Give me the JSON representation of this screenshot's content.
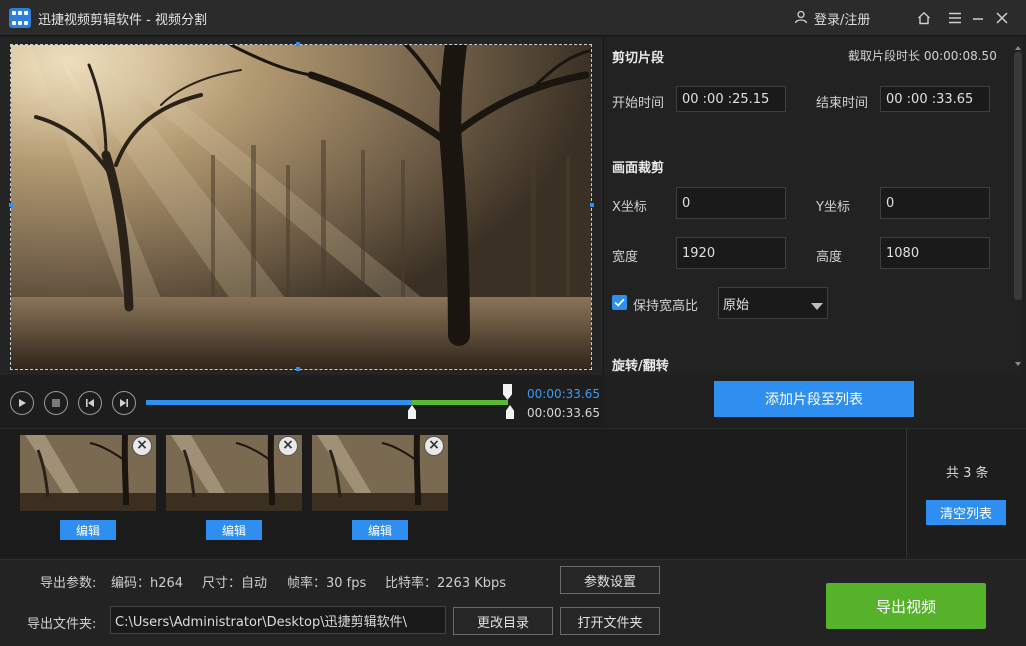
{
  "app": {
    "title": "迅捷视频剪辑软件 - 视频分割",
    "login_label": "登录/注册"
  },
  "icons": {
    "logo": "video-editor-logo-icon",
    "user": "user-icon",
    "home": "home-icon",
    "menu": "menu-icon",
    "minimize": "minimize-icon",
    "close": "close-icon"
  },
  "clip_section": {
    "title": "剪切片段",
    "duration_label": "截取片段时长",
    "duration_value": "00:00:08.50",
    "start_label": "开始时间",
    "start_value": "00 :00 :25.15",
    "end_label": "结束时间",
    "end_value": "00 :00 :33.65"
  },
  "crop_section": {
    "title": "画面裁剪",
    "x_label": "X坐标",
    "x_value": "0",
    "y_label": "Y坐标",
    "y_value": "0",
    "width_label": "宽度",
    "width_value": "1920",
    "height_label": "高度",
    "height_value": "1080",
    "keep_ratio_label": "保持宽高比",
    "keep_ratio_checked": true,
    "ratio_selected": "原始"
  },
  "rotate_section": {
    "title": "旋转/翻转"
  },
  "playback": {
    "current_time": "00:00:33.65",
    "end_time": "00:00:33.65",
    "played_fraction": 0.735,
    "selection_start_fraction": 0.735,
    "selection_end_fraction": 1.0
  },
  "add_clip_button": "添加片段至列表",
  "clips": [
    {
      "edit_label": "编辑"
    },
    {
      "edit_label": "编辑"
    },
    {
      "edit_label": "编辑"
    }
  ],
  "clip_list": {
    "count_label": "共 3 条",
    "clear_label": "清空列表"
  },
  "export": {
    "params_label": "导出参数:",
    "codec": "编码：h264",
    "size": "尺寸：自动",
    "fps": "帧率：30 fps",
    "bitrate": "比特率：2263 Kbps",
    "settings_button": "参数设置",
    "folder_label": "导出文件夹:",
    "folder_path": "C:\\Users\\Administrator\\Desktop\\迅捷剪辑软件\\",
    "change_dir_button": "更改目录",
    "open_folder_button": "打开文件夹",
    "export_button": "导出视频"
  },
  "colors": {
    "accent_blue": "#2e8ff0",
    "selection_green": "#5cb82e",
    "export_green": "#55b22a",
    "background": "#1f1f1f"
  }
}
